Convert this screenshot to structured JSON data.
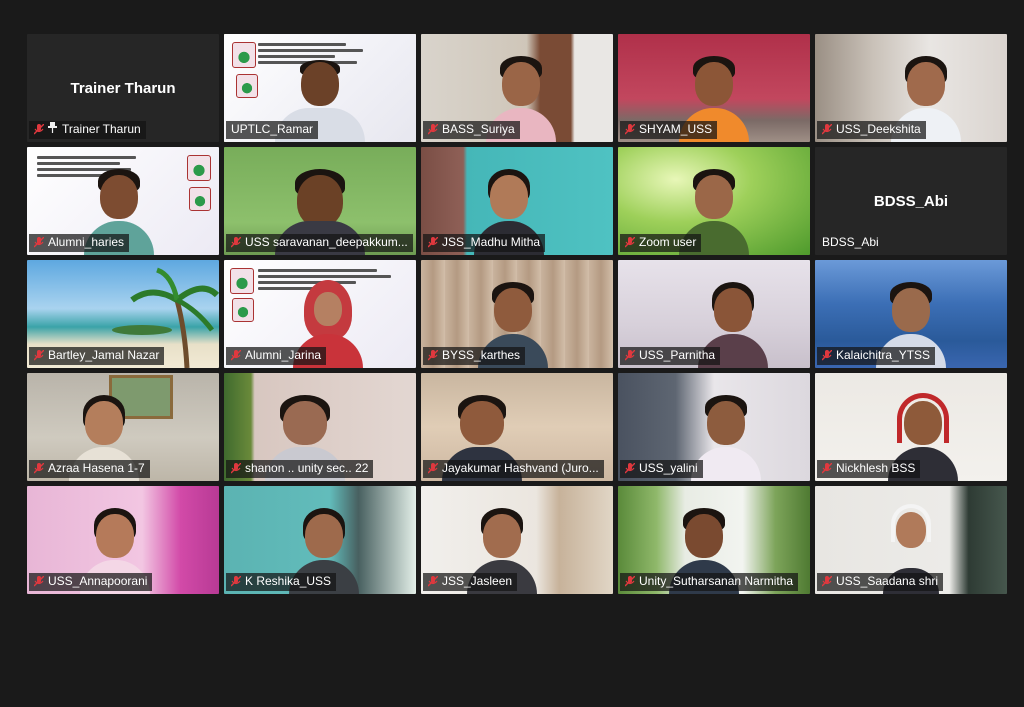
{
  "meeting": {
    "participants": [
      {
        "name": "Trainer Tharun",
        "display_name": "Trainer Tharun",
        "video": false,
        "muted": true,
        "pinned": true
      },
      {
        "name": "UPTLC_Ramar",
        "video": true,
        "muted": false,
        "active_speaker": true
      },
      {
        "name": "BASS_Suriya",
        "video": true,
        "muted": true
      },
      {
        "name": "SHYAM_USS",
        "video": true,
        "muted": true
      },
      {
        "name": "USS_Deekshita",
        "video": true,
        "muted": true
      },
      {
        "name": "Alumni_haries",
        "video": true,
        "muted": true
      },
      {
        "name": "USS saravanan_deepakkum...",
        "video": true,
        "muted": true
      },
      {
        "name": "JSS_Madhu Mitha",
        "video": true,
        "muted": true
      },
      {
        "name": "Zoom user",
        "video": true,
        "muted": true
      },
      {
        "name": "BDSS_Abi",
        "display_name": "BDSS_Abi",
        "video": false,
        "muted": false
      },
      {
        "name": "Bartley_Jamal Nazar",
        "video": true,
        "muted": true
      },
      {
        "name": "Alumni_Jarina",
        "video": true,
        "muted": true
      },
      {
        "name": "BYSS_karthes",
        "video": true,
        "muted": true
      },
      {
        "name": "USS_Parnitha",
        "video": true,
        "muted": true
      },
      {
        "name": "Kalaichitra_YTSS",
        "video": true,
        "muted": true
      },
      {
        "name": "Azraa Hasena 1-7",
        "video": true,
        "muted": true
      },
      {
        "name": "shanon    .. unity sec.. 22",
        "video": true,
        "muted": true
      },
      {
        "name": "Jayakumar Hashvand (Juro...",
        "video": true,
        "muted": true
      },
      {
        "name": "USS_yalini",
        "video": true,
        "muted": true
      },
      {
        "name": "Nickhlesh BSS",
        "video": true,
        "muted": true
      },
      {
        "name": "USS_Annapoorani",
        "video": true,
        "muted": true
      },
      {
        "name": "K Reshika_USS",
        "video": true,
        "muted": true
      },
      {
        "name": "JSS_Jasleen",
        "video": true,
        "muted": true
      },
      {
        "name": "Unity_Sutharsanan Narmitha",
        "video": true,
        "muted": true
      },
      {
        "name": "USS_Saadana shri",
        "video": true,
        "muted": true
      }
    ]
  },
  "icons": {
    "muted": "mic-off-icon",
    "pinned": "pin-icon"
  },
  "colors": {
    "muted_mic": "#e0383e",
    "active_border": "#d8e85a",
    "background": "#1a1a1a"
  }
}
